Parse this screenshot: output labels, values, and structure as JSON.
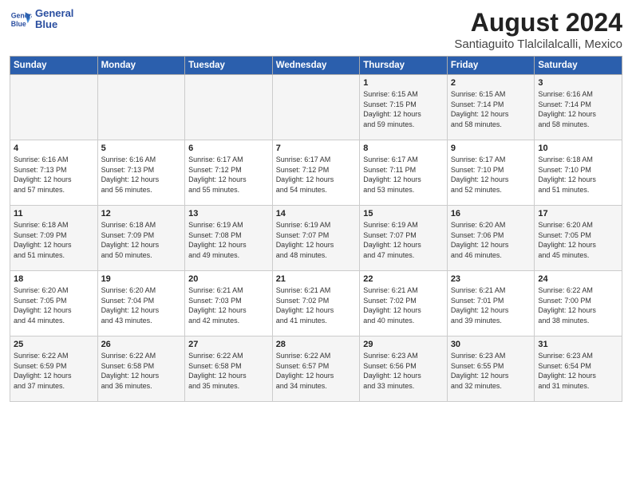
{
  "logo": {
    "line1": "General",
    "line2": "Blue"
  },
  "title": "August 2024",
  "subtitle": "Santiaguito Tlalcilalcalli, Mexico",
  "weekdays": [
    "Sunday",
    "Monday",
    "Tuesday",
    "Wednesday",
    "Thursday",
    "Friday",
    "Saturday"
  ],
  "weeks": [
    [
      {
        "day": "",
        "info": ""
      },
      {
        "day": "",
        "info": ""
      },
      {
        "day": "",
        "info": ""
      },
      {
        "day": "",
        "info": ""
      },
      {
        "day": "1",
        "info": "Sunrise: 6:15 AM\nSunset: 7:15 PM\nDaylight: 12 hours\nand 59 minutes."
      },
      {
        "day": "2",
        "info": "Sunrise: 6:15 AM\nSunset: 7:14 PM\nDaylight: 12 hours\nand 58 minutes."
      },
      {
        "day": "3",
        "info": "Sunrise: 6:16 AM\nSunset: 7:14 PM\nDaylight: 12 hours\nand 58 minutes."
      }
    ],
    [
      {
        "day": "4",
        "info": "Sunrise: 6:16 AM\nSunset: 7:13 PM\nDaylight: 12 hours\nand 57 minutes."
      },
      {
        "day": "5",
        "info": "Sunrise: 6:16 AM\nSunset: 7:13 PM\nDaylight: 12 hours\nand 56 minutes."
      },
      {
        "day": "6",
        "info": "Sunrise: 6:17 AM\nSunset: 7:12 PM\nDaylight: 12 hours\nand 55 minutes."
      },
      {
        "day": "7",
        "info": "Sunrise: 6:17 AM\nSunset: 7:12 PM\nDaylight: 12 hours\nand 54 minutes."
      },
      {
        "day": "8",
        "info": "Sunrise: 6:17 AM\nSunset: 7:11 PM\nDaylight: 12 hours\nand 53 minutes."
      },
      {
        "day": "9",
        "info": "Sunrise: 6:17 AM\nSunset: 7:10 PM\nDaylight: 12 hours\nand 52 minutes."
      },
      {
        "day": "10",
        "info": "Sunrise: 6:18 AM\nSunset: 7:10 PM\nDaylight: 12 hours\nand 51 minutes."
      }
    ],
    [
      {
        "day": "11",
        "info": "Sunrise: 6:18 AM\nSunset: 7:09 PM\nDaylight: 12 hours\nand 51 minutes."
      },
      {
        "day": "12",
        "info": "Sunrise: 6:18 AM\nSunset: 7:09 PM\nDaylight: 12 hours\nand 50 minutes."
      },
      {
        "day": "13",
        "info": "Sunrise: 6:19 AM\nSunset: 7:08 PM\nDaylight: 12 hours\nand 49 minutes."
      },
      {
        "day": "14",
        "info": "Sunrise: 6:19 AM\nSunset: 7:07 PM\nDaylight: 12 hours\nand 48 minutes."
      },
      {
        "day": "15",
        "info": "Sunrise: 6:19 AM\nSunset: 7:07 PM\nDaylight: 12 hours\nand 47 minutes."
      },
      {
        "day": "16",
        "info": "Sunrise: 6:20 AM\nSunset: 7:06 PM\nDaylight: 12 hours\nand 46 minutes."
      },
      {
        "day": "17",
        "info": "Sunrise: 6:20 AM\nSunset: 7:05 PM\nDaylight: 12 hours\nand 45 minutes."
      }
    ],
    [
      {
        "day": "18",
        "info": "Sunrise: 6:20 AM\nSunset: 7:05 PM\nDaylight: 12 hours\nand 44 minutes."
      },
      {
        "day": "19",
        "info": "Sunrise: 6:20 AM\nSunset: 7:04 PM\nDaylight: 12 hours\nand 43 minutes."
      },
      {
        "day": "20",
        "info": "Sunrise: 6:21 AM\nSunset: 7:03 PM\nDaylight: 12 hours\nand 42 minutes."
      },
      {
        "day": "21",
        "info": "Sunrise: 6:21 AM\nSunset: 7:02 PM\nDaylight: 12 hours\nand 41 minutes."
      },
      {
        "day": "22",
        "info": "Sunrise: 6:21 AM\nSunset: 7:02 PM\nDaylight: 12 hours\nand 40 minutes."
      },
      {
        "day": "23",
        "info": "Sunrise: 6:21 AM\nSunset: 7:01 PM\nDaylight: 12 hours\nand 39 minutes."
      },
      {
        "day": "24",
        "info": "Sunrise: 6:22 AM\nSunset: 7:00 PM\nDaylight: 12 hours\nand 38 minutes."
      }
    ],
    [
      {
        "day": "25",
        "info": "Sunrise: 6:22 AM\nSunset: 6:59 PM\nDaylight: 12 hours\nand 37 minutes."
      },
      {
        "day": "26",
        "info": "Sunrise: 6:22 AM\nSunset: 6:58 PM\nDaylight: 12 hours\nand 36 minutes."
      },
      {
        "day": "27",
        "info": "Sunrise: 6:22 AM\nSunset: 6:58 PM\nDaylight: 12 hours\nand 35 minutes."
      },
      {
        "day": "28",
        "info": "Sunrise: 6:22 AM\nSunset: 6:57 PM\nDaylight: 12 hours\nand 34 minutes."
      },
      {
        "day": "29",
        "info": "Sunrise: 6:23 AM\nSunset: 6:56 PM\nDaylight: 12 hours\nand 33 minutes."
      },
      {
        "day": "30",
        "info": "Sunrise: 6:23 AM\nSunset: 6:55 PM\nDaylight: 12 hours\nand 32 minutes."
      },
      {
        "day": "31",
        "info": "Sunrise: 6:23 AM\nSunset: 6:54 PM\nDaylight: 12 hours\nand 31 minutes."
      }
    ]
  ]
}
